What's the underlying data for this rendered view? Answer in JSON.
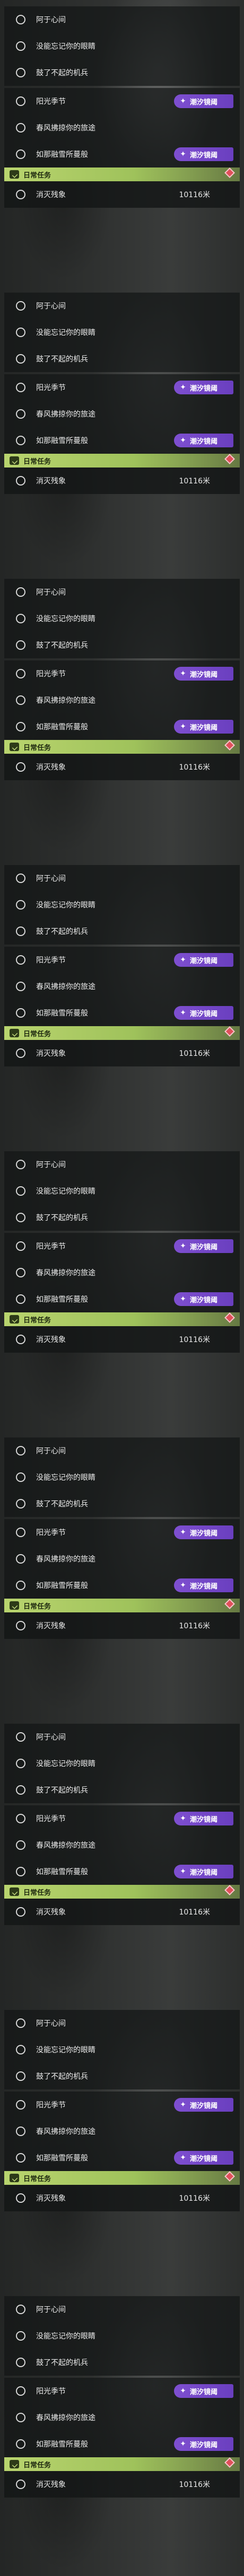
{
  "tasks": [
    {
      "label": "阿于心间",
      "chip": ""
    },
    {
      "label": "没能忘记你的眼睛",
      "chip": ""
    },
    {
      "label": "鼓了不起的机兵",
      "chip": ""
    },
    {
      "label": "阳光季节",
      "chip": "潮汐镜阈"
    },
    {
      "label": "春风拂掠你的旅途",
      "chip": ""
    },
    {
      "label": "如那融雪所蔓般",
      "chip": "潮汐镜阈"
    }
  ],
  "daily": {
    "header": "日常任务",
    "task_label": "消灭残象",
    "distance": "10116米"
  },
  "colors": {
    "chip_purple": "#7e4fd0",
    "daily_green": "#b9d46e",
    "alert_red": "#e0505a"
  },
  "icons": {
    "task_status": "circle-outline-icon",
    "chip": "sparkle-icon",
    "daily": "calendar-icon",
    "alert": "diamond-gem-icon"
  }
}
